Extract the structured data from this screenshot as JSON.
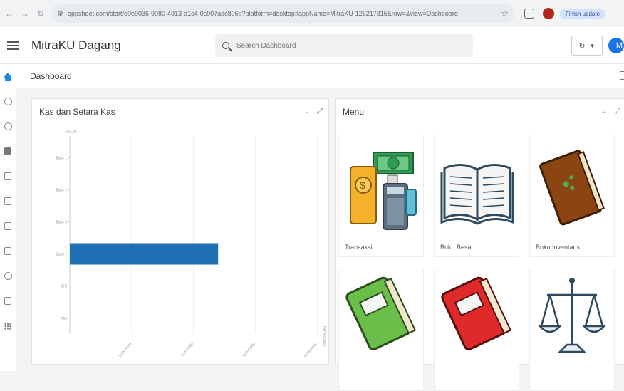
{
  "browser": {
    "url": "appsheet.com/start/e0e9036-9080-4913-a1c4-0c907adc806b?platform=desktop#appName=MitraKU-126217315&row=&view=Dashboard",
    "update_label": "Finish update"
  },
  "app": {
    "title": "MitraKU Dagang",
    "search_placeholder": "Search Dashboard",
    "avatar_initial": "M"
  },
  "breadcrumb": {
    "title": "Dashboard"
  },
  "kas_panel": {
    "title": "Kas dan Setara Kas",
    "chart_data": {
      "type": "bar",
      "orientation": "horizontal",
      "categories": [
        "Bank 1",
        "Bank 2",
        "Bank 3",
        "Bank 1",
        "BRI",
        "Kas"
      ],
      "values": [
        0,
        0,
        0,
        24000000,
        0,
        0
      ],
      "series_color": "#1f6fb5",
      "top_label": "AKUN",
      "x_ticks": [
        "10,000,000",
        "20,000,000",
        "30,000,000",
        "40,000,000"
      ],
      "x_axis_label": "SUM SALDO",
      "xlim": [
        0,
        40000000
      ],
      "grid": true
    }
  },
  "menu_panel": {
    "title": "Menu",
    "items": [
      {
        "label": "Transaksi",
        "icon": "money-payment-icon"
      },
      {
        "label": "Buku Besar",
        "icon": "open-book-icon"
      },
      {
        "label": "Buku Inventaris",
        "icon": "brown-book-icon"
      },
      {
        "label": "",
        "icon": "green-book-icon"
      },
      {
        "label": "",
        "icon": "red-book-icon"
      },
      {
        "label": "",
        "icon": "balance-scale-icon"
      }
    ]
  }
}
